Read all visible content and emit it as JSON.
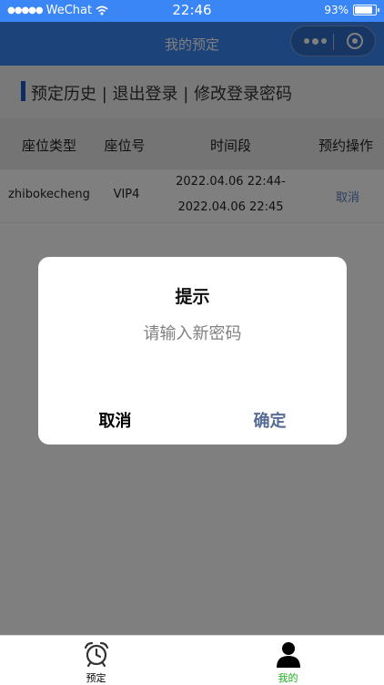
{
  "status_bar": {
    "carrier": "WeChat",
    "time": "22:46",
    "battery": "93%"
  },
  "nav": {
    "title": "我的预定"
  },
  "section": {
    "links_text": "预定历史 | 退出登录 | 修改登录密码"
  },
  "table": {
    "headers": [
      "座位类型",
      "座位号",
      "时间段",
      "预约操作"
    ],
    "rows": [
      {
        "seat_type": "zhibokecheng",
        "seat_no": "VIP4",
        "time_start": "2022.04.06 22:44-",
        "time_end": "2022.04.06 22:45",
        "action": "取消"
      }
    ]
  },
  "dialog": {
    "title": "提示",
    "placeholder": "请输入新密码",
    "cancel_label": "取消",
    "confirm_label": "确定"
  },
  "tabbar": {
    "items": [
      {
        "label": "预定",
        "icon": "alarm-clock-icon",
        "active": false
      },
      {
        "label": "我的",
        "icon": "user-icon",
        "active": true
      }
    ]
  },
  "colors": {
    "nav_bg": "#3b86f6",
    "accent": "#1d57c9",
    "confirm": "#576b95",
    "link": "#5b7ec4",
    "tab_active": "#1aad19"
  }
}
